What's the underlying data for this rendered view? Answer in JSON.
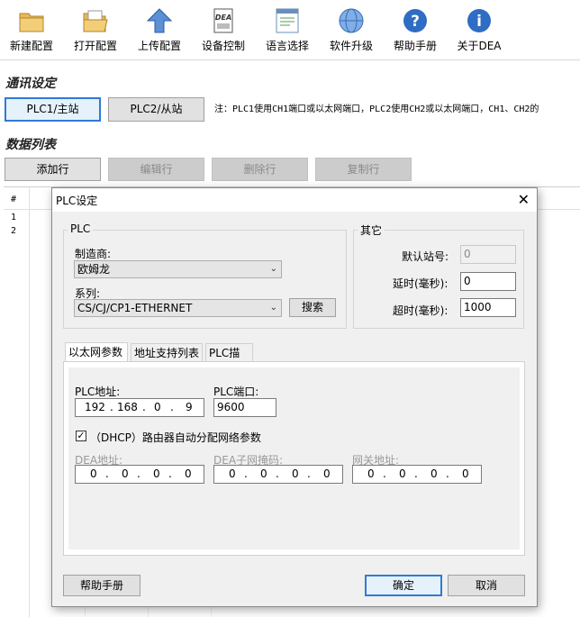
{
  "toolbar": {
    "items": [
      {
        "label": "新建配置",
        "icon": "folder-icon"
      },
      {
        "label": "打开配置",
        "icon": "open-folder-icon"
      },
      {
        "label": "上传配置",
        "icon": "upload-arrow-icon"
      },
      {
        "label": "设备控制",
        "icon": "dea-device-icon"
      },
      {
        "label": "语言选择",
        "icon": "language-icon"
      },
      {
        "label": "软件升级",
        "icon": "globe-icon"
      },
      {
        "label": "帮助手册",
        "icon": "help-icon"
      },
      {
        "label": "关于DEA",
        "icon": "info-icon"
      }
    ]
  },
  "comm": {
    "title": "通讯设定",
    "plc1": "PLC1/主站",
    "plc2": "PLC2/从站",
    "note": "注：PLC1使用CH1端口或以太网端口，PLC2使用CH2或以太网端口，CH1、CH2的"
  },
  "datalist": {
    "title": "数据列表",
    "add": "添加行",
    "edit": "编辑行",
    "delete": "删除行",
    "copy": "复制行",
    "header": "#",
    "rows": [
      "1",
      "2"
    ]
  },
  "dialog": {
    "title": "PLC设定",
    "close": "✕",
    "plc_group": "PLC",
    "manufacturer_label": "制造商:",
    "manufacturer_value": "欧姆龙",
    "series_label": "系列:",
    "series_value": "CS/CJ/CP1-ETHERNET",
    "search": "搜索",
    "other_group": "其它",
    "station_label": "默认站号:",
    "station_value": "0",
    "delay_label": "延时(毫秒):",
    "delay_value": "0",
    "timeout_label": "超时(毫秒):",
    "timeout_value": "1000",
    "tabs": [
      "以太网参数",
      "地址支持列表",
      "PLC描述"
    ],
    "plc_addr_label": "PLC地址:",
    "plc_addr": [
      "192",
      "168",
      "0",
      "9"
    ],
    "plc_port_label": "PLC端口:",
    "plc_port": "9600",
    "dhcp_label": "（DHCP）路由器自动分配网络参数",
    "dhcp_checked": true,
    "dea_addr_label": "DEA地址:",
    "dea_addr": [
      "0",
      "0",
      "0",
      "0"
    ],
    "mask_label": "DEA子网掩码:",
    "mask": [
      "0",
      "0",
      "0",
      "0"
    ],
    "gateway_label": "网关地址:",
    "gateway": [
      "0",
      "0",
      "0",
      "0"
    ],
    "help": "帮助手册",
    "ok": "确定",
    "cancel": "取消"
  }
}
